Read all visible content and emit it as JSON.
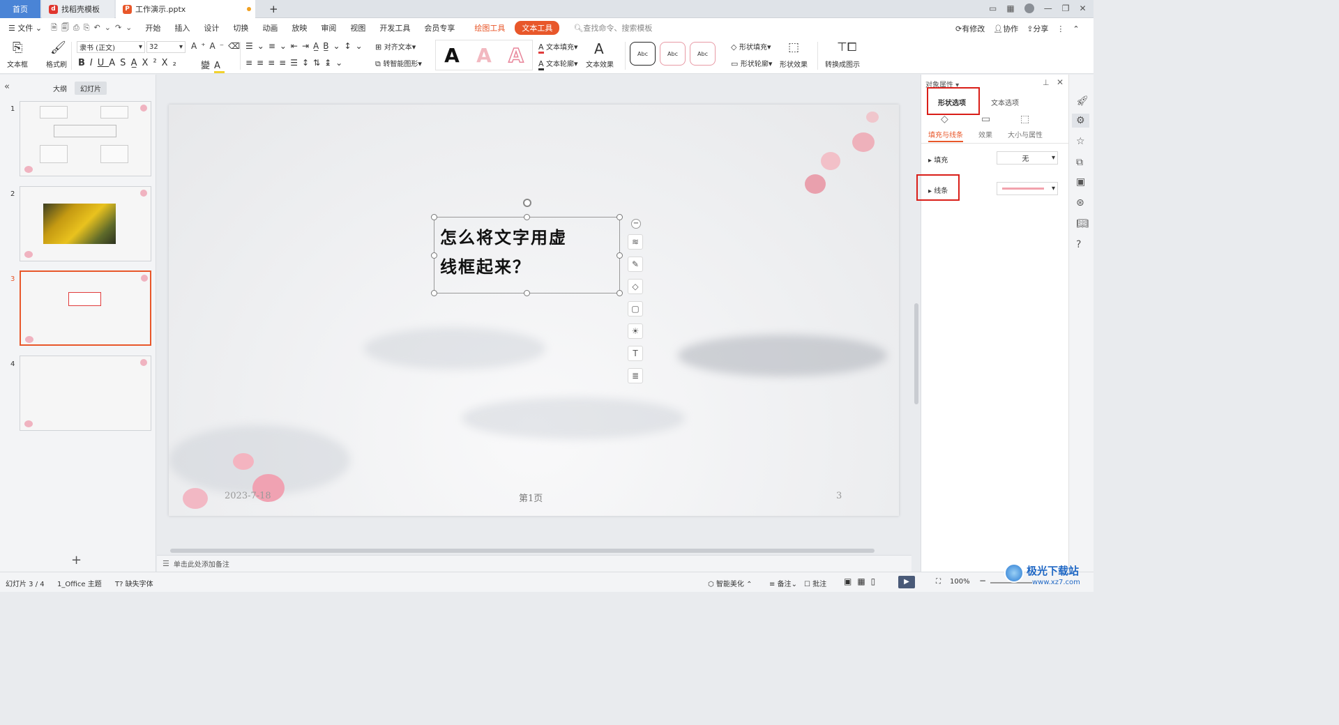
{
  "tabs": {
    "home": "首页",
    "template": "找稻壳模板",
    "doc": "工作演示.pptx",
    "add": "+"
  },
  "menu": {
    "file": "文件",
    "items": [
      "开始",
      "插入",
      "设计",
      "切换",
      "动画",
      "放映",
      "审阅",
      "视图",
      "开发工具",
      "会员专享"
    ],
    "drawing_tools": "绘图工具",
    "text_tools": "文本工具",
    "search": "查找命令、搜索模板",
    "modify": "有修改",
    "collab": "协作",
    "share": "分享"
  },
  "toolbar": {
    "textbox": "文本框",
    "format_painter": "格式刷",
    "font": "隶书 (正文)",
    "size": "32",
    "align_text": "对齐文本",
    "smart_art": "转智能图形",
    "text_fill": "文本填充",
    "text_outline": "文本轮廓",
    "text_effect": "文本效果",
    "shape_fill": "形状填充",
    "shape_outline": "形状轮廓",
    "shape_effect": "形状效果",
    "convert": "转换成图示",
    "abc": "Abc",
    "wordart": "A"
  },
  "left": {
    "outline": "大纲",
    "slides": "幻灯片",
    "nums": [
      "1",
      "2",
      "3",
      "4"
    ],
    "add": "+"
  },
  "slide": {
    "text_line1": "怎么将文字用虚",
    "text_line2": "线框起来？",
    "date": "2023-7-18",
    "page": "第1页",
    "num": "3"
  },
  "notes": "单击此处添加备注",
  "props": {
    "header": "对象属性",
    "tab_shape": "形状选项",
    "tab_text": "文本选项",
    "sub_fill_line": "填充与线条",
    "sub_effect": "效果",
    "sub_size": "大小与属性",
    "fill": "填充",
    "fill_value": "无",
    "line": "线条"
  },
  "status": {
    "slide": "幻灯片 3 / 4",
    "theme": "1_Office 主题",
    "font": "缺失字体",
    "beautify": "智能美化",
    "notes": "备注",
    "comment": "批注",
    "zoom": "100%"
  },
  "watermark": {
    "name": "极光下载站",
    "url": "www.xz7.com"
  },
  "colors": {
    "accent": "#e8572a",
    "blue": "#4a84d6",
    "red": "#d91e18",
    "pink_line": "#f2a2ad"
  }
}
